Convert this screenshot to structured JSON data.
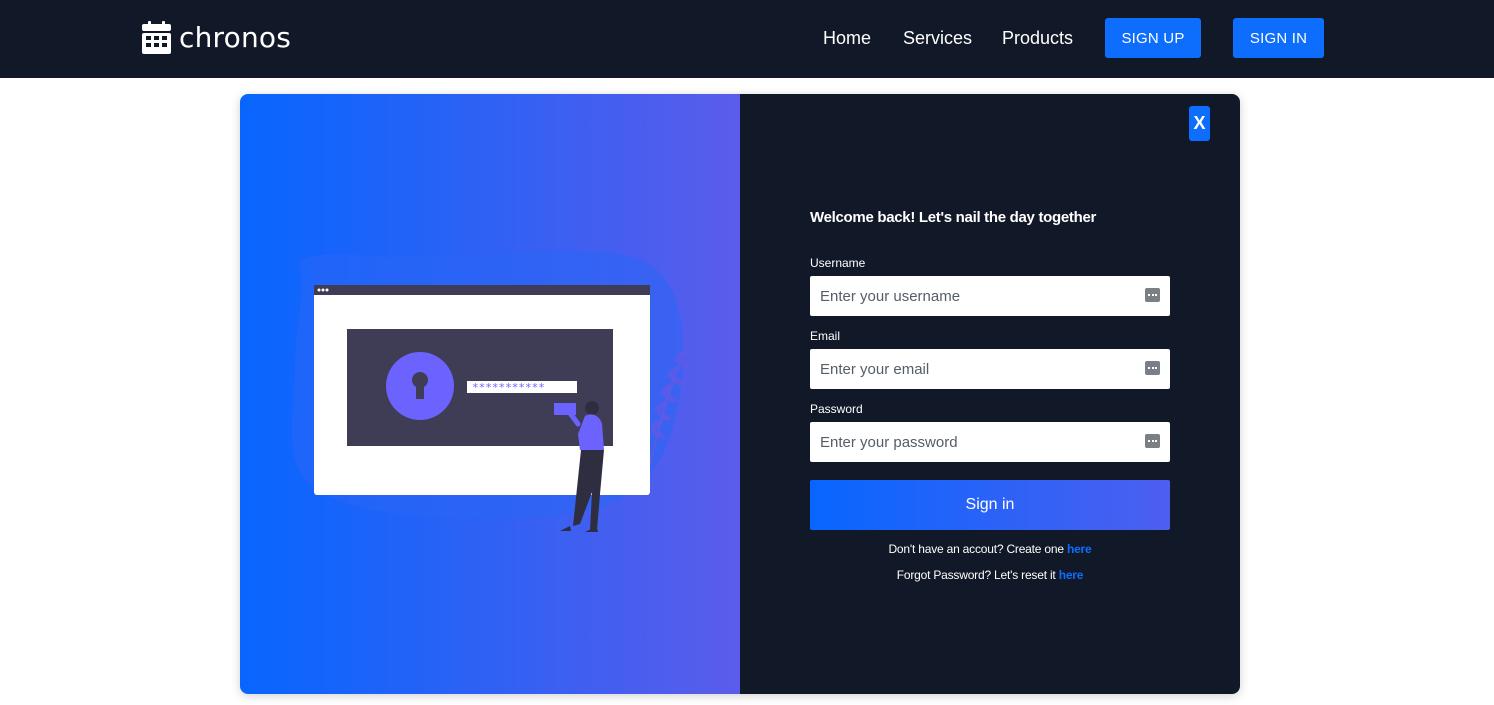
{
  "navbar": {
    "brand": "chronos",
    "brand_icon": "calendar-icon",
    "links": [
      "Home",
      "Services",
      "Products"
    ],
    "signup_label": "SIGN UP",
    "signin_label": "SIGN IN"
  },
  "modal": {
    "close_label": "X",
    "illustration_password_mask": "***********",
    "welcome": "Welcome back! Let's nail the day together",
    "fields": {
      "username": {
        "label": "Username",
        "placeholder": "Enter your username",
        "icon": "password-manager-icon"
      },
      "email": {
        "label": "Email",
        "placeholder": "Enter your email",
        "icon": "password-manager-icon"
      },
      "password": {
        "label": "Password",
        "placeholder": "Enter your password",
        "icon": "password-manager-icon"
      }
    },
    "signin_button": "Sign in",
    "create_account_text": "Don't have an accout? Create one ",
    "create_account_link": "here",
    "forgot_text": "Forgot Password? Let's reset it ",
    "forgot_link": "here"
  },
  "colors": {
    "navbar_bg": "#111827",
    "accent": "#0d6efd",
    "gradient_start": "#0766ff",
    "gradient_end": "#5b5ceb",
    "illustration_dark": "#3f3d56",
    "illustration_purple": "#6c63ff"
  }
}
